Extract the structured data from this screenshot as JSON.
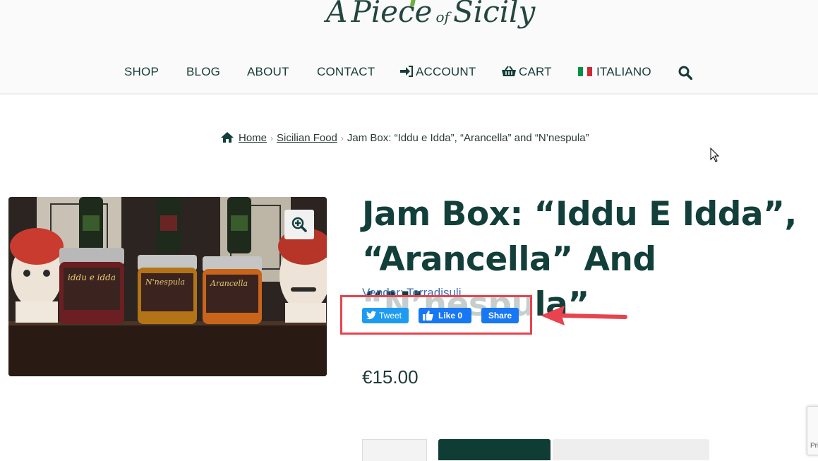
{
  "brand": {
    "logo_text_a": "A",
    "logo_text_piece": "Piece",
    "logo_text_of": "of",
    "logo_text_sicily": "Sicily",
    "logo_color": "#23463f"
  },
  "nav": {
    "shop": "SHOP",
    "blog": "BLOG",
    "about": "ABOUT",
    "contact": "CONTACT",
    "account": "ACCOUNT",
    "cart": "CART",
    "language": "ITALIANO",
    "account_icon": "sign-in-icon",
    "cart_icon": "basket-icon",
    "language_icon": "italy-flag-icon",
    "search_icon": "search-icon"
  },
  "breadcrumb": {
    "home": "Home",
    "category": "Sicilian Food",
    "current": "Jam Box: “Iddu e Idda”, “Arancella” and “N’nespula”"
  },
  "product": {
    "title": "Jam Box: “Iddu E Idda”, “Arancella” And “N’nespula”",
    "vendor": "Vendor: Terradisuli",
    "price": "€15.00",
    "title_color": "#123f3a",
    "vendor_color": "#3b6fb6",
    "zoom_icon": "zoom-in-icon",
    "image_labels": {
      "jar1": "iddu e idda",
      "jar2": "N'nespula",
      "jar3": "Arancella"
    }
  },
  "social": {
    "tweet": "Tweet",
    "like": "Like 0",
    "share": "Share",
    "twitter_color": "#1d9bf0",
    "facebook_color": "#1877f2"
  },
  "annotation": {
    "highlight_color": "#e8434e"
  },
  "recaptcha": {
    "label": "Pri"
  }
}
